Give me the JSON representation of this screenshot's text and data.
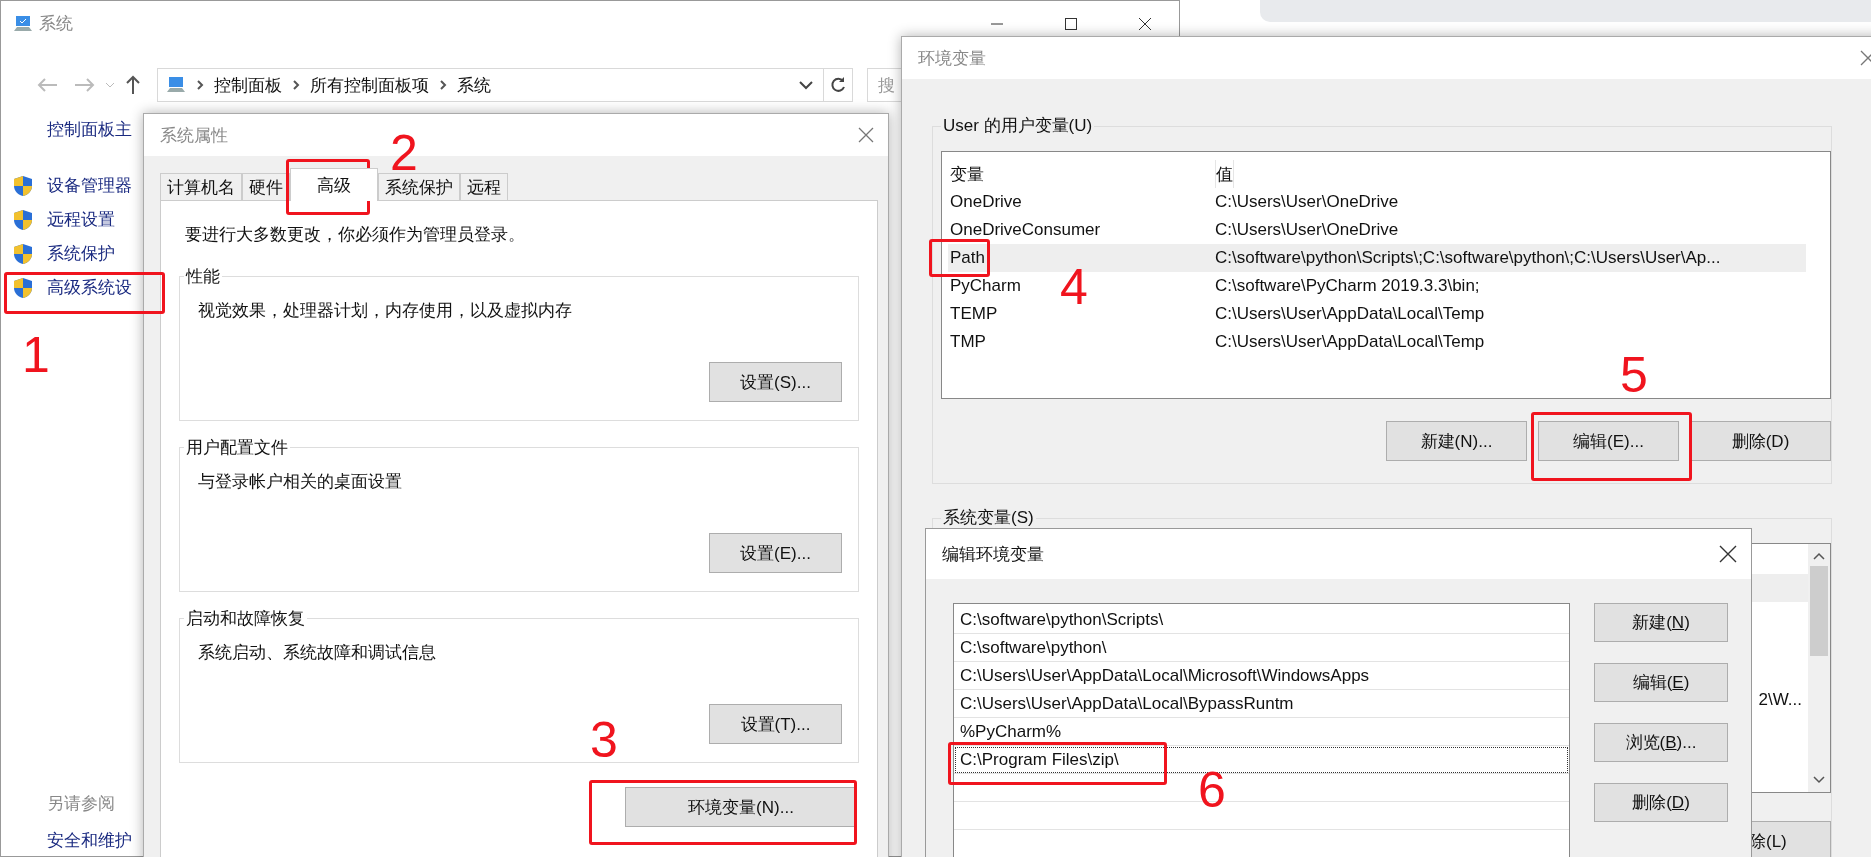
{
  "system_window": {
    "title": "系统",
    "breadcrumb": [
      "控制面板",
      "所有控制面板项",
      "系统"
    ],
    "search": {
      "placeholder": "搜"
    },
    "sidebar": {
      "home_link": "控制面板主",
      "items": [
        {
          "label": "设备管理器"
        },
        {
          "label": "远程设置"
        },
        {
          "label": "系统保护"
        },
        {
          "label": "高级系统设"
        }
      ],
      "see_also": {
        "heading": "另请参阅",
        "links": [
          "安全和维护"
        ]
      }
    }
  },
  "system_properties": {
    "title": "系统属性",
    "tabs": [
      {
        "label": "计算机名",
        "selected": false
      },
      {
        "label": "硬件",
        "selected": false
      },
      {
        "label": "高级",
        "selected": true
      },
      {
        "label": "系统保护",
        "selected": false
      },
      {
        "label": "远程",
        "selected": false
      }
    ],
    "notice": "要进行大多数更改，你必须作为管理员登录。",
    "groups": [
      {
        "title": "性能",
        "description": "视觉效果，处理器计划，内存使用，以及虚拟内存",
        "button": "设置(S)..."
      },
      {
        "title": "用户配置文件",
        "description": "与登录帐户相关的桌面设置",
        "button": "设置(E)..."
      },
      {
        "title": "启动和故障恢复",
        "description": "系统启动、系统故障和调试信息",
        "button": "设置(T)..."
      }
    ],
    "env_button": "环境变量(N)..."
  },
  "environment_variables": {
    "title": "环境变量",
    "user_group": {
      "title": "User 的用户变量(U)",
      "columns": [
        "变量",
        "值"
      ],
      "rows": [
        {
          "name": "OneDrive",
          "value": "C:\\Users\\User\\OneDrive",
          "selected": false
        },
        {
          "name": "OneDriveConsumer",
          "value": "C:\\Users\\User\\OneDrive",
          "selected": false
        },
        {
          "name": "Path",
          "value": "C:\\software\\python\\Scripts\\;C:\\software\\python\\;C:\\Users\\User\\Ap...",
          "selected": true
        },
        {
          "name": "PyCharm",
          "value": "C:\\software\\PyCharm 2019.3.3\\bin;",
          "selected": false
        },
        {
          "name": "TEMP",
          "value": "C:\\Users\\User\\AppData\\Local\\Temp",
          "selected": false
        },
        {
          "name": "TMP",
          "value": "C:\\Users\\User\\AppData\\Local\\Temp",
          "selected": false
        }
      ],
      "buttons": [
        "新建(N)...",
        "编辑(E)...",
        "删除(D)"
      ]
    },
    "system_group": {
      "title": "系统变量(S)",
      "rows": [
        {
          "selected": false
        },
        {
          "selected": true
        },
        {
          "selected": false
        },
        {
          "selected": false
        },
        {
          "selected": false
        },
        {
          "value": "2\\W...",
          "selected": false
        },
        {
          "selected": false
        },
        {
          "selected": false
        }
      ],
      "button": "除(L)"
    }
  },
  "edit_dialog": {
    "title": "编辑环境变量",
    "entries": [
      {
        "text": "C:\\software\\python\\Scripts\\",
        "selected": false
      },
      {
        "text": "C:\\software\\python\\",
        "selected": false
      },
      {
        "text": "C:\\Users\\User\\AppData\\Local\\Microsoft\\WindowsApps",
        "selected": false
      },
      {
        "text": "C:\\Users\\User\\AppData\\Local\\BypassRuntm",
        "selected": false
      },
      {
        "text": "%PyCharm%",
        "selected": false
      },
      {
        "text": "C:\\Program Files\\zip\\",
        "selected": true
      }
    ],
    "buttons": [
      {
        "before": "新建(",
        "access_key": "N",
        "after": ")"
      },
      {
        "before": "编辑(",
        "access_key": "E",
        "after": ")"
      },
      {
        "before": "浏览(",
        "access_key": "B",
        "after": ")..."
      },
      {
        "before": "删除(",
        "access_key": "D",
        "after": ")"
      }
    ]
  },
  "annotations": [
    {
      "label": "1"
    },
    {
      "label": "2"
    },
    {
      "label": "3"
    },
    {
      "label": "4"
    },
    {
      "label": "5"
    },
    {
      "label": "6"
    }
  ]
}
